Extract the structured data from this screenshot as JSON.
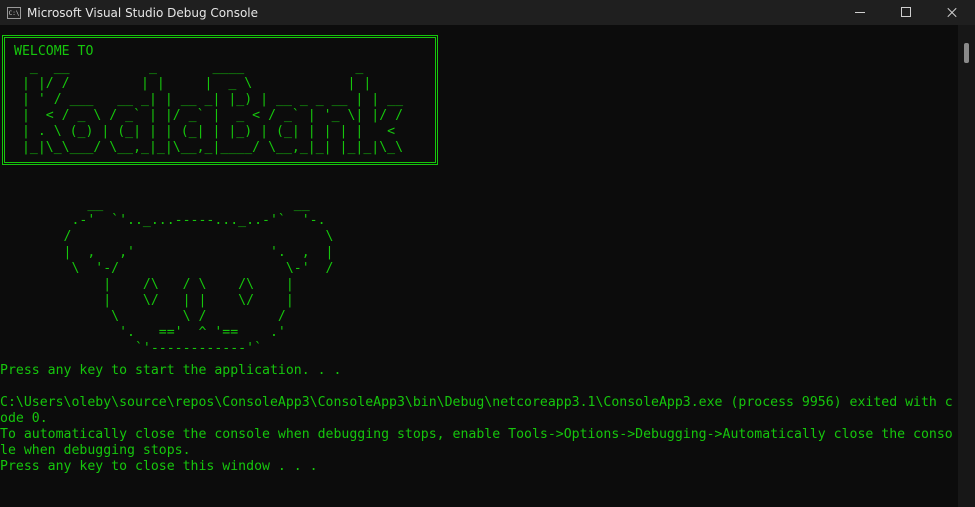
{
  "window": {
    "title": "Microsoft Visual Studio Debug Console",
    "icon": "console-app-icon",
    "icon_glyph": "C:\\",
    "controls": [
      "minimize-icon",
      "maximize-icon",
      "close-icon"
    ]
  },
  "banner": {
    "welcome": "WELCOME TO",
    "art": "  _  __          _       ____              _\n | |/ /         | |     |  _ \\            | |\n | ' / ___   __ _| | __ _| |_) | __ _ _ __ | | __\n |  < / _ \\ / _` | |/ _` |  _ < / _` | '_ \\| |/ /\n | . \\ (_) | (_| | | (_| | |_) | (_| | | | |   <\n |_|\\_\\___/ \\__,_|_|\\__,_|____/ \\__,_|_| |_|_|\\_\\"
  },
  "koala": {
    "art": "           __                        __\n         .-'  `'.._...-----..._..-'`  '-.\n        /                                \\\n        |  ,   ,'                 '.  ,  |\n         \\  '-/                     \\-'  /\n             |    /\\   / \\    /\\    |\n             |    \\/   | |    \\/    |\n              \\        \\ /         /\n               '.   =='  ^ '==    .'\n                 `'------------'`"
  },
  "console": {
    "lines": [
      "Press any key to start the application. . .",
      "",
      "C:\\Users\\oleby\\source\\repos\\ConsoleApp3\\ConsoleApp3\\bin\\Debug\\netcoreapp3.1\\ConsoleApp3.exe (process 9956) exited with c",
      "ode 0.",
      "To automatically close the console when debugging stops, enable Tools->Options->Debugging->Automatically close the conso",
      "le when debugging stops.",
      "Press any key to close this window . . ."
    ]
  },
  "colors": {
    "console_text": "#16c60c",
    "background": "#0c0c0c",
    "titlebar": "#1f1f1f"
  }
}
